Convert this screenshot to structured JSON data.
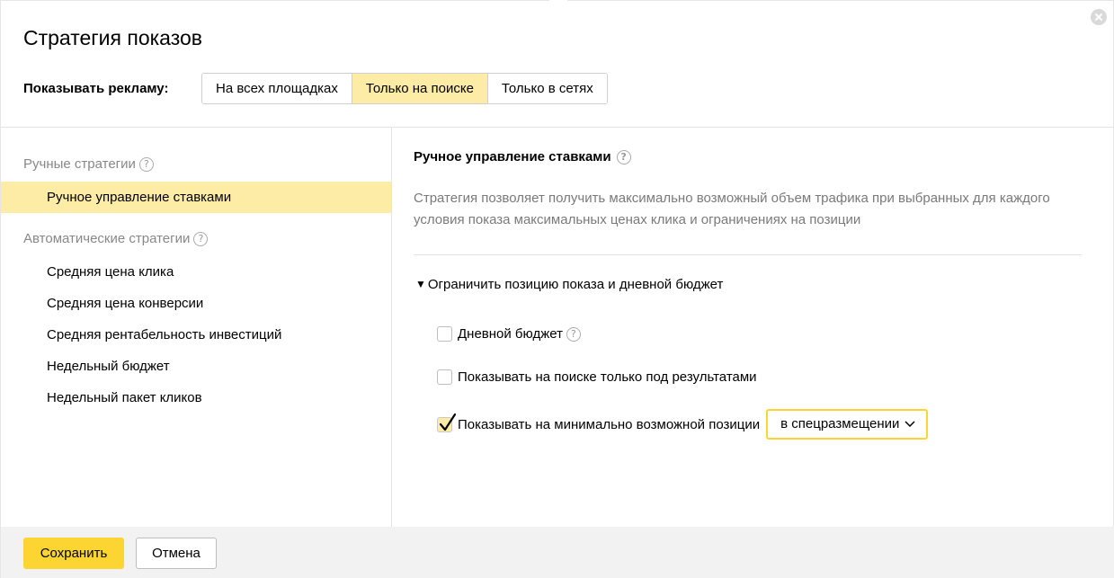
{
  "dialog": {
    "title": "Стратегия показов",
    "close_icon": "close-icon"
  },
  "show_ads": {
    "label": "Показывать рекламу:",
    "options": [
      {
        "label": "На всех площадках",
        "active": false
      },
      {
        "label": "Только на поиске",
        "active": true
      },
      {
        "label": "Только в сетях",
        "active": false
      }
    ]
  },
  "left": {
    "manual_group": {
      "label": "Ручные стратегии",
      "help": "?"
    },
    "manual_items": [
      {
        "label": "Ручное управление ставками",
        "active": true
      }
    ],
    "auto_group": {
      "label": "Автоматические стратегии",
      "help": "?"
    },
    "auto_items": [
      {
        "label": "Средняя цена клика"
      },
      {
        "label": "Средняя цена конверсии"
      },
      {
        "label": "Средняя рентабельность инвестиций"
      },
      {
        "label": "Недельный бюджет"
      },
      {
        "label": "Недельный пакет кликов"
      }
    ]
  },
  "right": {
    "title": "Ручное управление ставками",
    "help": "?",
    "description": "Стратегия позволяет получить максимально возможный объем трафика при выбранных для каждого условия показа максимальных ценах клика и ограничениях на позиции",
    "expander": {
      "arrow": "▼",
      "label": "Ограничить позицию показа и дневной бюджет"
    },
    "options": [
      {
        "label": "Дневной бюджет",
        "checked": false,
        "help": "?"
      },
      {
        "label": "Показывать на поиске только под результатами",
        "checked": false
      },
      {
        "label": "Показывать на минимально возможной позиции",
        "checked": true
      }
    ],
    "position_select": {
      "value": "в спецразмещении"
    }
  },
  "footer": {
    "save_label": "Сохранить",
    "cancel_label": "Отмена"
  },
  "colors": {
    "accent": "#fcd533",
    "active_bg": "#fdeca6",
    "muted_text": "#7a7a7a"
  }
}
